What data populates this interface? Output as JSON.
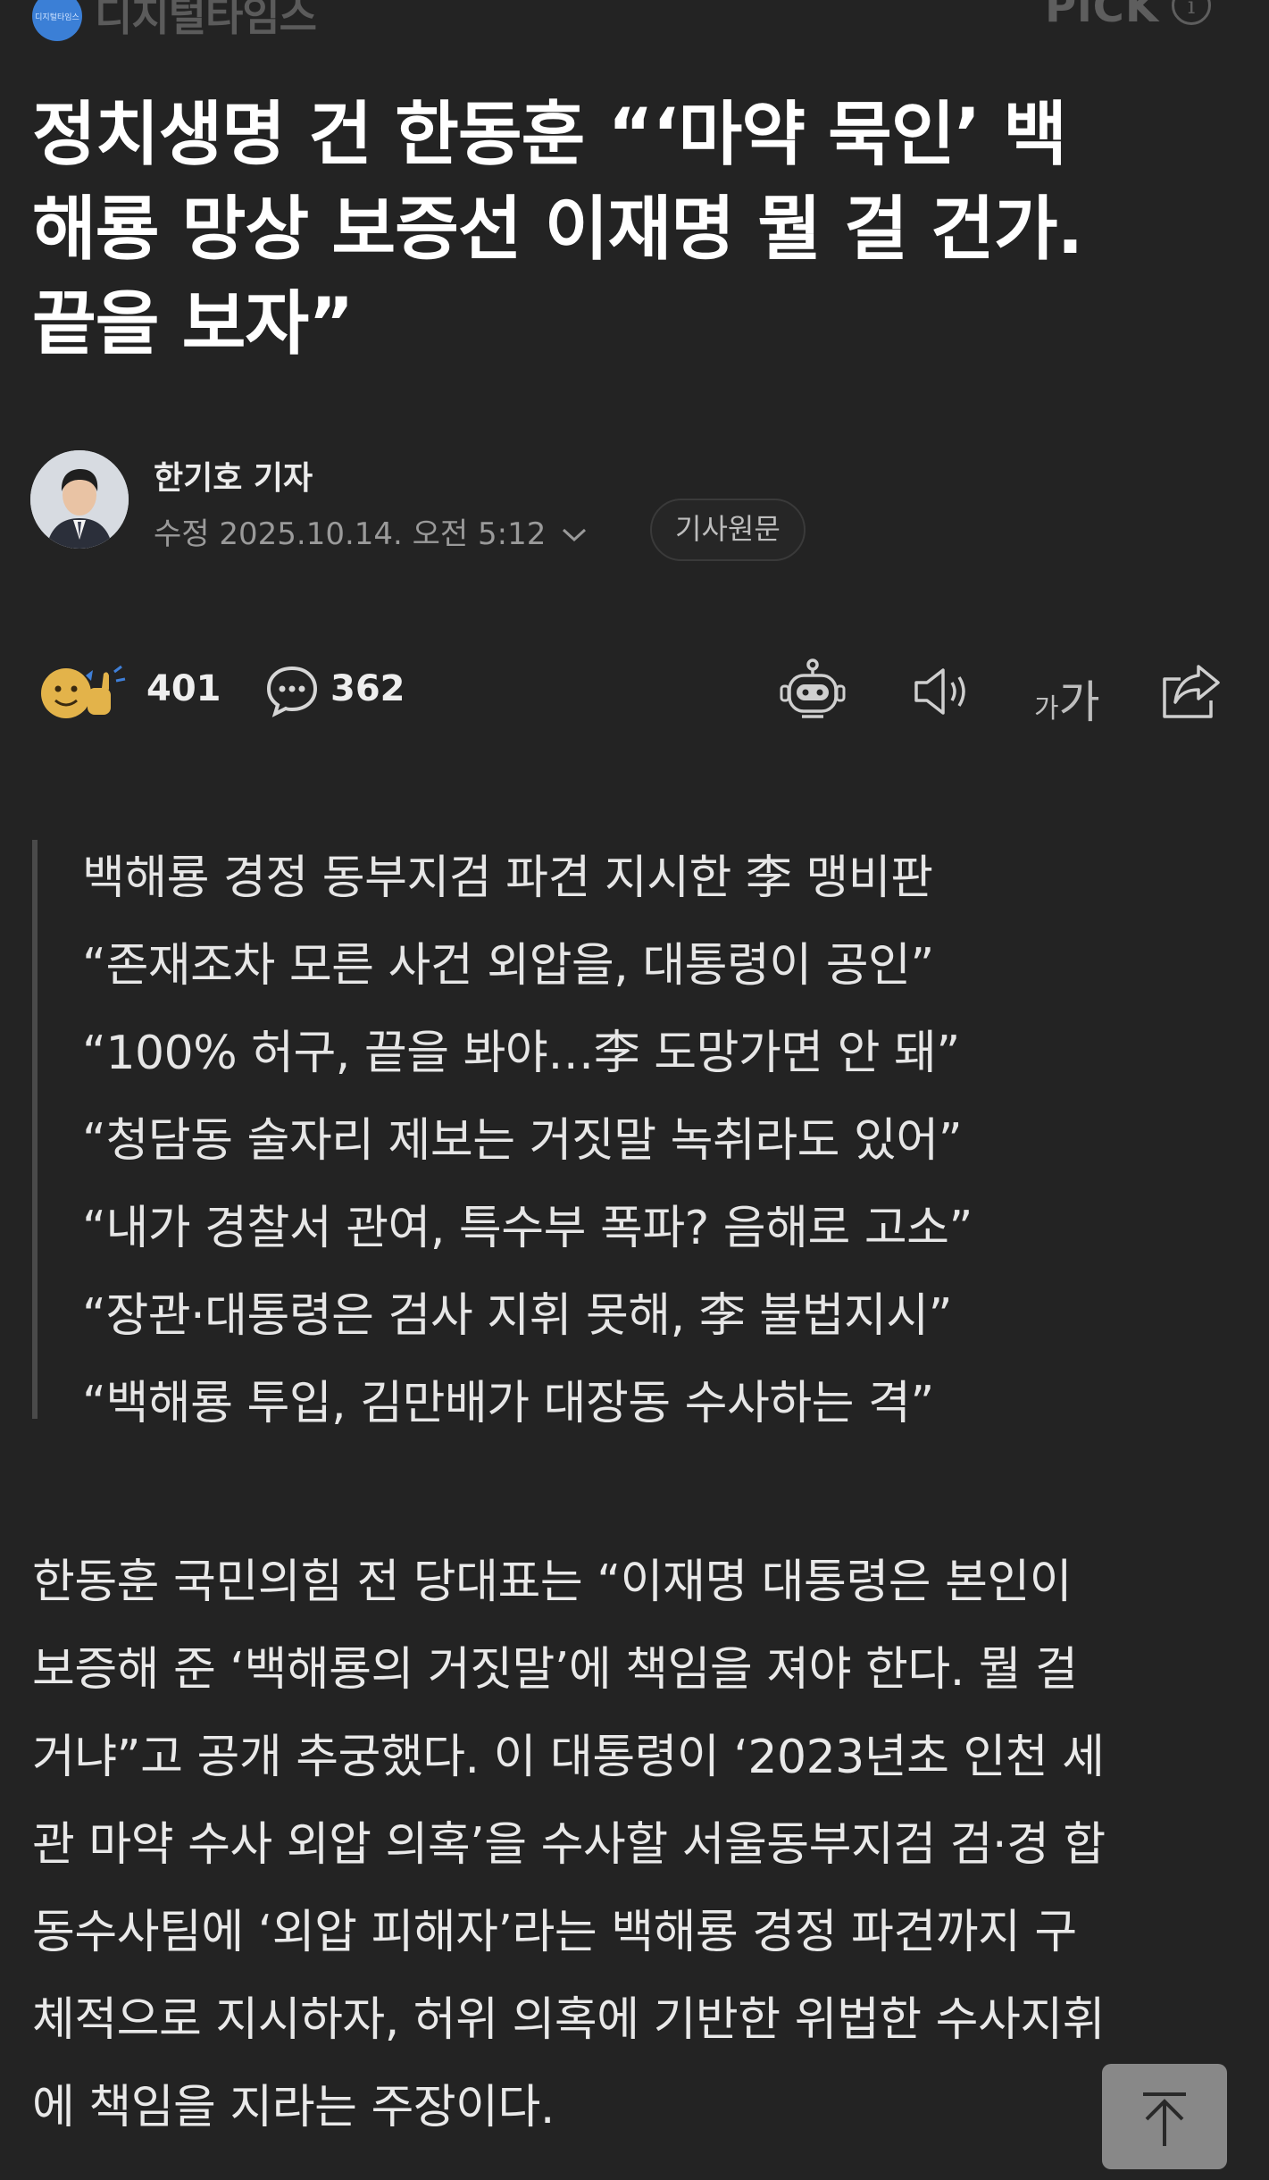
{
  "press": {
    "logo_text": "디지털타임스",
    "name": "디지털타임스",
    "pick_label": "PiCK",
    "info_icon": "info-icon"
  },
  "headline": {
    "lines": [
      "정치생명 건 한동훈 “‘마약 묵인’ 백",
      "해룡 망상 보증선 이재명 뭘 걸 건가.",
      "끝을 보자”"
    ]
  },
  "byline": {
    "author": "한기호 기자",
    "modified": "수정 2025.10.14. 오전 5:12",
    "original_button": "기사원문"
  },
  "actions": {
    "reactions_count": "401",
    "comments_count": "362",
    "font_size_small": "가",
    "font_size_large": "가",
    "icons": [
      "robot-summary-icon",
      "speaker-icon",
      "font-size-icon",
      "share-icon"
    ]
  },
  "summary": {
    "lines": [
      "백해룡 경정 동부지검 파견 지시한 李 맹비판",
      "“존재조차 모른 사건 외압을, 대통령이 공인”",
      "“100% 허구, 끝을 봐야…李 도망가면 안 돼”",
      "“청담동 술자리 제보는 거짓말 녹취라도 있어”",
      "“내가 경찰서 관여, 특수부 폭파? 음해로 고소”",
      "“장관·대통령은 검사 지휘 못해, 李 불법지시”",
      "“백해룡 투입, 김만배가 대장동 수사하는 격”"
    ]
  },
  "body": {
    "lines": [
      "한동훈 국민의힘 전 당대표는 “이재명 대통령은 본인이",
      "보증해 준 ‘백해룡의 거짓말’에 책임을 져야 한다. 뭘 걸",
      "거냐”고 공개 추궁했다. 이 대통령이 ‘2023년초 인천 세",
      "관 마약 수사 외압 의혹’을 수사할 서울동부지검 검·경 합",
      "동수사팀에 ‘외압 피해자’라는 백해룡 경정 파견까지 구",
      "체적으로 지시하자, 허위 의혹에 기반한 위법한 수사지휘",
      "에 책임을 지라는 주장이다."
    ]
  },
  "colors": {
    "background": "#232323",
    "text": "#f2f2f2",
    "muted": "#9a9a9a",
    "press_logo": "#3b7fd6",
    "top_button": "#8e8e8e"
  }
}
